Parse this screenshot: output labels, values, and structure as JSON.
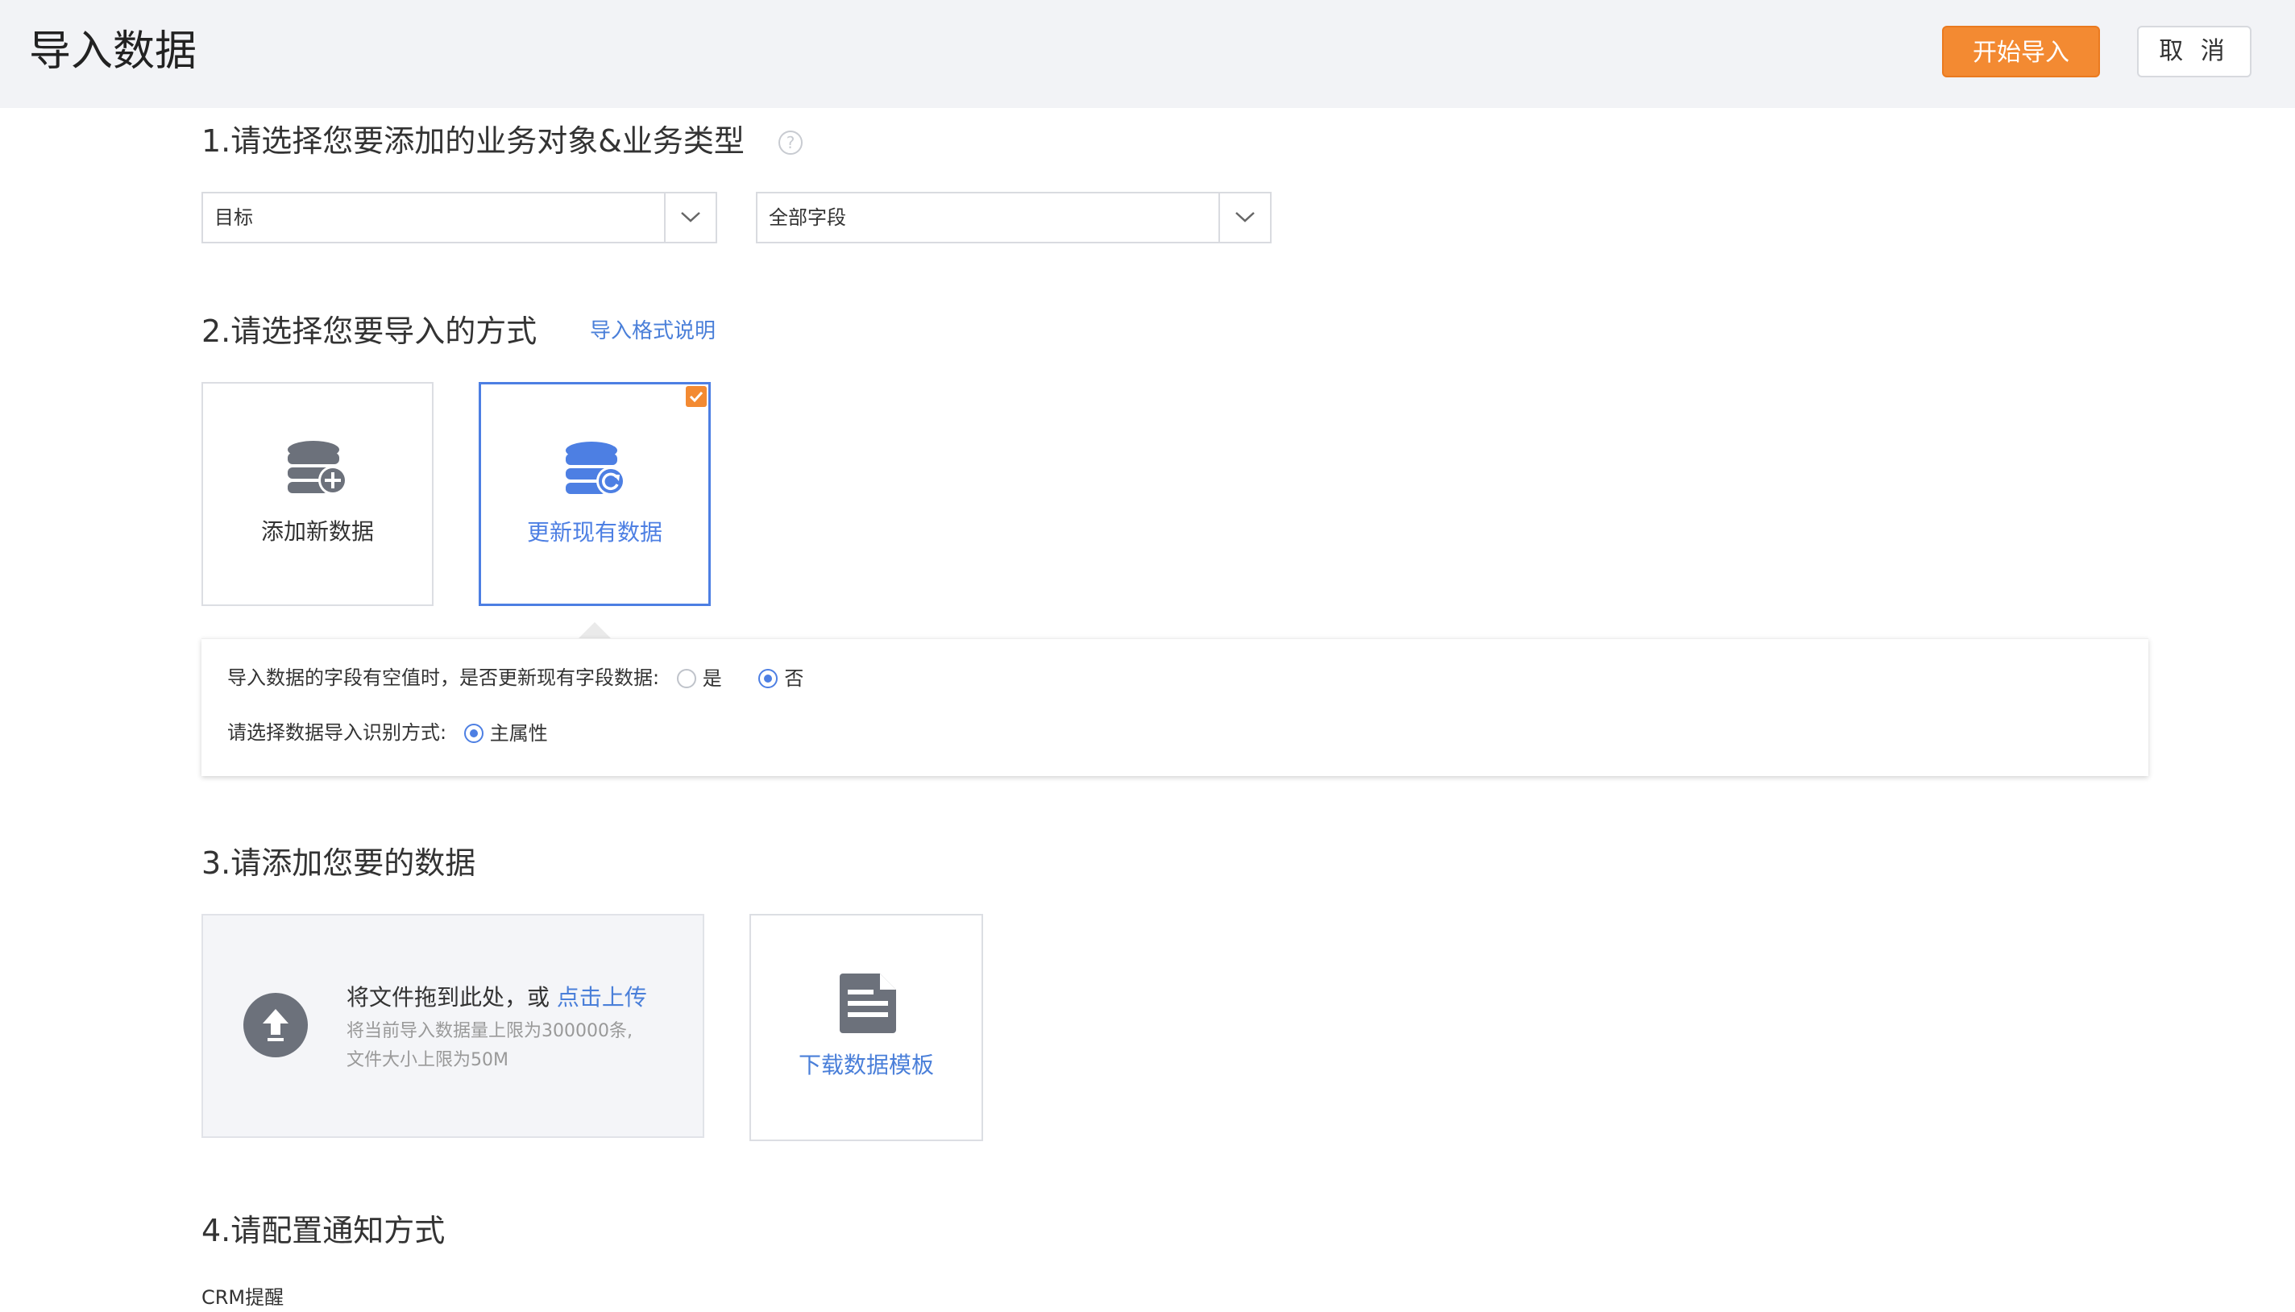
{
  "header": {
    "title": "导入数据",
    "start_button": "开始导入",
    "cancel_button": "取 消"
  },
  "section1": {
    "title": "1.请选择您要添加的业务对象&业务类型",
    "help_icon": "question-circle-icon",
    "object_select": "目标",
    "type_select": "全部字段"
  },
  "section2": {
    "title": "2.请选择您要导入的方式",
    "format_link": "导入格式说明",
    "methods": [
      {
        "label": "添加新数据",
        "icon": "database-add-icon",
        "selected": false
      },
      {
        "label": "更新现有数据",
        "icon": "database-refresh-icon",
        "selected": true
      }
    ],
    "options": {
      "empty_field_question": "导入数据的字段有空值时，是否更新现有字段数据:",
      "yes": "是",
      "no": "否",
      "empty_field_selected": "否",
      "identify_question": "请选择数据导入识别方式:",
      "identify_option": "主属性"
    }
  },
  "section3": {
    "title": "3.请添加您要的数据",
    "upload_text": "将文件拖到此处，或",
    "upload_link": "点击上传",
    "upload_limit_line1": "将当前导入数据量上限为300000条,",
    "upload_limit_line2": "文件大小上限为50M",
    "template_label": "下载数据模板"
  },
  "section4": {
    "title": "4.请配置通知方式",
    "crm_label": "CRM提醒"
  },
  "colors": {
    "accent": "#f38a32",
    "primary_blue": "#4d7fe3",
    "link_blue": "#4a7fd9",
    "header_bg": "#f2f3f6"
  }
}
